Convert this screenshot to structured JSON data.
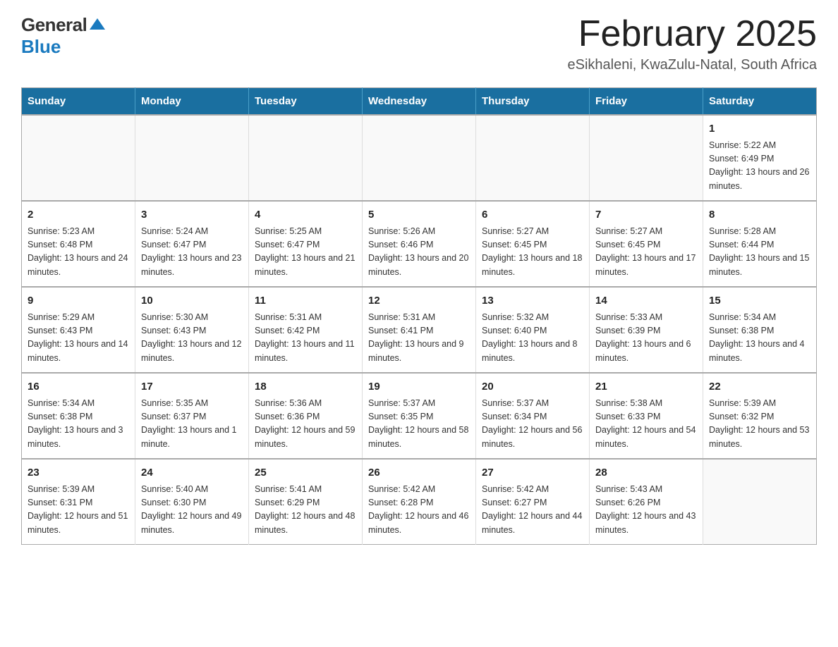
{
  "logo": {
    "general": "General",
    "blue": "Blue"
  },
  "title": "February 2025",
  "location": "eSikhaleni, KwaZulu-Natal, South Africa",
  "days_of_week": [
    "Sunday",
    "Monday",
    "Tuesday",
    "Wednesday",
    "Thursday",
    "Friday",
    "Saturday"
  ],
  "weeks": [
    [
      {
        "day": "",
        "info": ""
      },
      {
        "day": "",
        "info": ""
      },
      {
        "day": "",
        "info": ""
      },
      {
        "day": "",
        "info": ""
      },
      {
        "day": "",
        "info": ""
      },
      {
        "day": "",
        "info": ""
      },
      {
        "day": "1",
        "info": "Sunrise: 5:22 AM\nSunset: 6:49 PM\nDaylight: 13 hours and 26 minutes."
      }
    ],
    [
      {
        "day": "2",
        "info": "Sunrise: 5:23 AM\nSunset: 6:48 PM\nDaylight: 13 hours and 24 minutes."
      },
      {
        "day": "3",
        "info": "Sunrise: 5:24 AM\nSunset: 6:47 PM\nDaylight: 13 hours and 23 minutes."
      },
      {
        "day": "4",
        "info": "Sunrise: 5:25 AM\nSunset: 6:47 PM\nDaylight: 13 hours and 21 minutes."
      },
      {
        "day": "5",
        "info": "Sunrise: 5:26 AM\nSunset: 6:46 PM\nDaylight: 13 hours and 20 minutes."
      },
      {
        "day": "6",
        "info": "Sunrise: 5:27 AM\nSunset: 6:45 PM\nDaylight: 13 hours and 18 minutes."
      },
      {
        "day": "7",
        "info": "Sunrise: 5:27 AM\nSunset: 6:45 PM\nDaylight: 13 hours and 17 minutes."
      },
      {
        "day": "8",
        "info": "Sunrise: 5:28 AM\nSunset: 6:44 PM\nDaylight: 13 hours and 15 minutes."
      }
    ],
    [
      {
        "day": "9",
        "info": "Sunrise: 5:29 AM\nSunset: 6:43 PM\nDaylight: 13 hours and 14 minutes."
      },
      {
        "day": "10",
        "info": "Sunrise: 5:30 AM\nSunset: 6:43 PM\nDaylight: 13 hours and 12 minutes."
      },
      {
        "day": "11",
        "info": "Sunrise: 5:31 AM\nSunset: 6:42 PM\nDaylight: 13 hours and 11 minutes."
      },
      {
        "day": "12",
        "info": "Sunrise: 5:31 AM\nSunset: 6:41 PM\nDaylight: 13 hours and 9 minutes."
      },
      {
        "day": "13",
        "info": "Sunrise: 5:32 AM\nSunset: 6:40 PM\nDaylight: 13 hours and 8 minutes."
      },
      {
        "day": "14",
        "info": "Sunrise: 5:33 AM\nSunset: 6:39 PM\nDaylight: 13 hours and 6 minutes."
      },
      {
        "day": "15",
        "info": "Sunrise: 5:34 AM\nSunset: 6:38 PM\nDaylight: 13 hours and 4 minutes."
      }
    ],
    [
      {
        "day": "16",
        "info": "Sunrise: 5:34 AM\nSunset: 6:38 PM\nDaylight: 13 hours and 3 minutes."
      },
      {
        "day": "17",
        "info": "Sunrise: 5:35 AM\nSunset: 6:37 PM\nDaylight: 13 hours and 1 minute."
      },
      {
        "day": "18",
        "info": "Sunrise: 5:36 AM\nSunset: 6:36 PM\nDaylight: 12 hours and 59 minutes."
      },
      {
        "day": "19",
        "info": "Sunrise: 5:37 AM\nSunset: 6:35 PM\nDaylight: 12 hours and 58 minutes."
      },
      {
        "day": "20",
        "info": "Sunrise: 5:37 AM\nSunset: 6:34 PM\nDaylight: 12 hours and 56 minutes."
      },
      {
        "day": "21",
        "info": "Sunrise: 5:38 AM\nSunset: 6:33 PM\nDaylight: 12 hours and 54 minutes."
      },
      {
        "day": "22",
        "info": "Sunrise: 5:39 AM\nSunset: 6:32 PM\nDaylight: 12 hours and 53 minutes."
      }
    ],
    [
      {
        "day": "23",
        "info": "Sunrise: 5:39 AM\nSunset: 6:31 PM\nDaylight: 12 hours and 51 minutes."
      },
      {
        "day": "24",
        "info": "Sunrise: 5:40 AM\nSunset: 6:30 PM\nDaylight: 12 hours and 49 minutes."
      },
      {
        "day": "25",
        "info": "Sunrise: 5:41 AM\nSunset: 6:29 PM\nDaylight: 12 hours and 48 minutes."
      },
      {
        "day": "26",
        "info": "Sunrise: 5:42 AM\nSunset: 6:28 PM\nDaylight: 12 hours and 46 minutes."
      },
      {
        "day": "27",
        "info": "Sunrise: 5:42 AM\nSunset: 6:27 PM\nDaylight: 12 hours and 44 minutes."
      },
      {
        "day": "28",
        "info": "Sunrise: 5:43 AM\nSunset: 6:26 PM\nDaylight: 12 hours and 43 minutes."
      },
      {
        "day": "",
        "info": ""
      }
    ]
  ]
}
